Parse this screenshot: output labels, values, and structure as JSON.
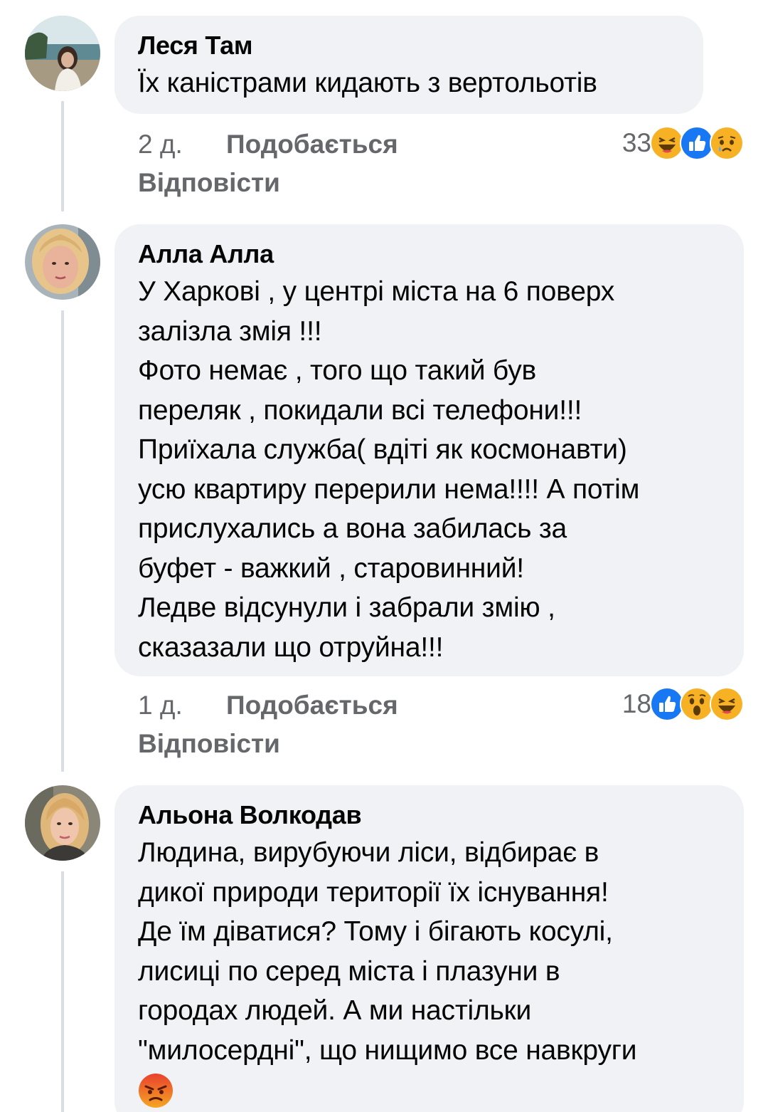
{
  "comments": [
    {
      "author": "Леся Там",
      "text": "Їх каністрами кидають з вертольотів",
      "time": "2 д.",
      "like_label": "Подобається",
      "reply_label": "Відповісти",
      "reaction_count": "33",
      "reactions": [
        "haha",
        "like",
        "sad"
      ]
    },
    {
      "author": "Алла Алла",
      "text": "У Харкові , у центрі міста на 6 поверх\nзалізла змія !!!\nФото немає , того що такий був\nпереляк , покидали всі телефони!!!\nПриїхала служба(  вдіті як космонавти)\nусю квартиру перерили нема!!!! А потім\nприслухались а вона забилась за\nбуфет - важкий , старовинний!\nЛедве відсунули і забрали змію ,\nсказазали що отруйна!!!",
      "time": "1 д.",
      "like_label": "Подобається",
      "reply_label": "Відповісти",
      "reaction_count": "18",
      "reactions": [
        "like",
        "wow",
        "haha"
      ]
    },
    {
      "author": "Альона Волкодав",
      "text": "Людина, вирубуючи ліси, відбирає в\nдикої природи території їх існування!\nДе їм діватися? Тому і бігають косулі,\nлисиці по серед міста і плазуни в\nгородах людей. А ми настільки\n\"милосердні\", що нищимо все навкруги",
      "trailing_emoji": "angry-face"
    }
  ],
  "colors": {
    "bubble": "#f0f2f5",
    "meta_text": "#65676b",
    "like_blue": "#1877f2",
    "emoji_yellow": "#f7b125",
    "angry_red": "#e9710f"
  }
}
